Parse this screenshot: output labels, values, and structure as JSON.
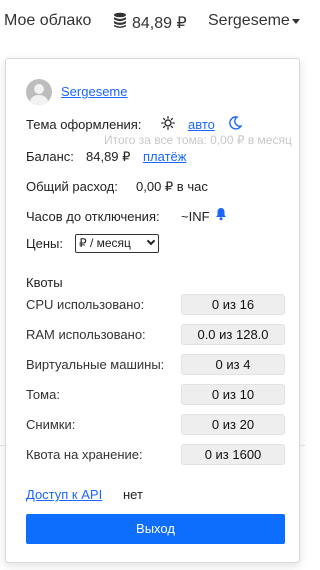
{
  "topbar": {
    "cloud_label": "Мое облако",
    "balance": "84,89 ₽",
    "username": "Sergeseme"
  },
  "panel": {
    "username": "Sergeseme",
    "theme": {
      "label": "Тема оформления:",
      "value": "авто"
    },
    "ghost_text": "Итого за все тома: 0,00 ₽ в месяц",
    "balance": {
      "label": "Баланс:",
      "value": "84,89 ₽",
      "link": "платёж"
    },
    "expense": {
      "label": "Общий расход:",
      "value": "0,00 ₽ в час"
    },
    "hours": {
      "label": "Часов до отключения:",
      "value": "~INF"
    },
    "prices": {
      "label": "Цены:",
      "selected": "₽ / месяц"
    },
    "quotas": {
      "title": "Квоты",
      "items": [
        {
          "label": "CPU использовано:",
          "value": "0 из 16"
        },
        {
          "label": "RAM использовано:",
          "value": "0.0 из 128.0"
        },
        {
          "label": "Виртуальные машины:",
          "value": "0 из 4"
        },
        {
          "label": "Тома:",
          "value": "0 из 10"
        },
        {
          "label": "Снимки:",
          "value": "0 из 20"
        },
        {
          "label": "Квота на хранение:",
          "value": "0 из 1600"
        }
      ]
    },
    "api": {
      "label": "Доступ к API",
      "value": "нет"
    },
    "logout": "Выход"
  },
  "icons": {
    "coins": "coins-icon",
    "sun": "sun-icon",
    "moon": "moon-icon",
    "bell": "bell-icon",
    "avatar": "user-avatar"
  },
  "colors": {
    "accent": "#0d6efd",
    "link": "#1a66ff"
  }
}
